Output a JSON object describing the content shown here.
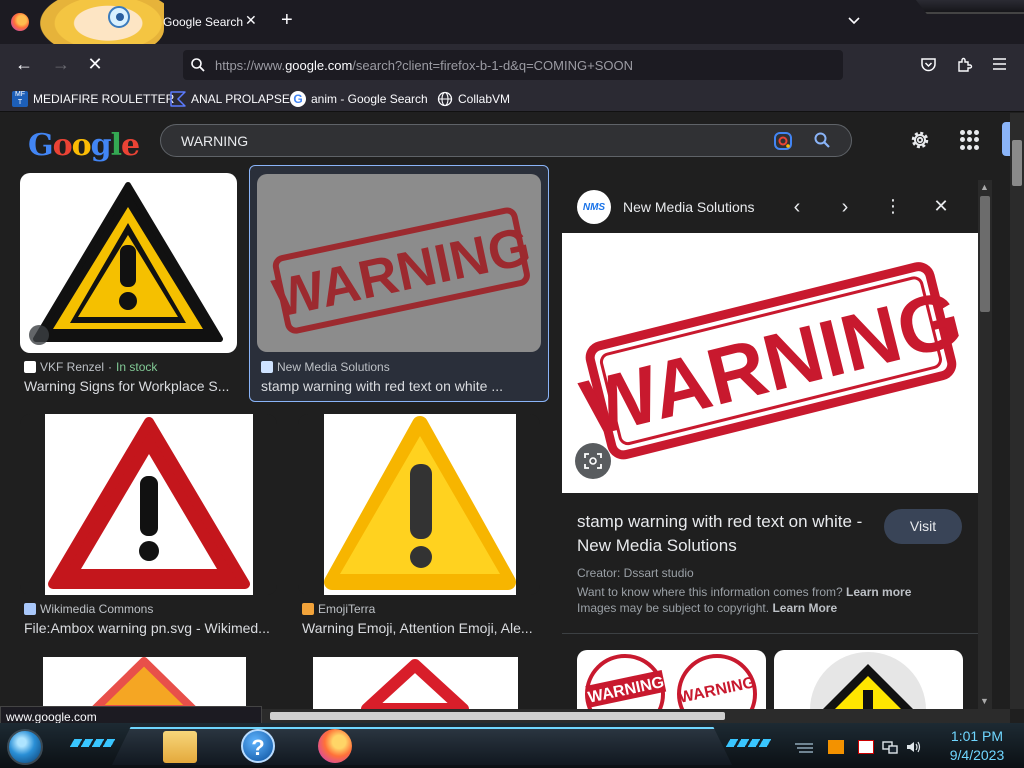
{
  "browser": {
    "tab": {
      "title": "Google Search"
    },
    "url": {
      "prefix": "https://www.",
      "host": "google.com",
      "path": "/search?client=firefox-b-1-d&q=COMING+SOON"
    },
    "bookmarks": [
      {
        "label": "MEDIAFIRE ROULETTER"
      },
      {
        "label": "ANAL PROLAPSE"
      },
      {
        "label": "anim - Google Search"
      },
      {
        "label": "CollabVM"
      }
    ],
    "status_url": "www.google.com"
  },
  "google": {
    "logo_letters": [
      "G",
      "o",
      "o",
      "g",
      "l",
      "e"
    ],
    "search_query": "WARNING"
  },
  "results": [
    {
      "source": "VKF Renzel",
      "stock": "In stock",
      "title": "Warning Signs for Workplace S..."
    },
    {
      "source": "New Media Solutions",
      "title": "stamp warning with red text on white ..."
    },
    {
      "source": "Wikimedia Commons",
      "title": "File:Ambox warning pn.svg - Wikimed..."
    },
    {
      "source": "EmojiTerra",
      "title": "Warning Emoji, Attention Emoji, Ale..."
    }
  ],
  "preview": {
    "site_name": "New Media Solutions",
    "site_logo_text": "NMS",
    "stamp_text": "WARNING",
    "title": "stamp warning with red text on white - New Media Solutions",
    "visit_label": "Visit",
    "creator": "Creator: Dssart studio",
    "info_q": "Want to know where this information comes from?",
    "info_link": "Learn more",
    "copyright": "Images may be subject to copyright.",
    "copyright_link": "Learn More",
    "related_stamp_text": "WARNING"
  },
  "taskbar": {
    "time": "1:01 PM",
    "date": "9/4/2023"
  },
  "colors": {
    "accent": "#8ab4f8",
    "stamp_red": "#c8192e",
    "warning_yellow": "#f5c000",
    "taskbar_cyan": "#6fd6ff"
  }
}
